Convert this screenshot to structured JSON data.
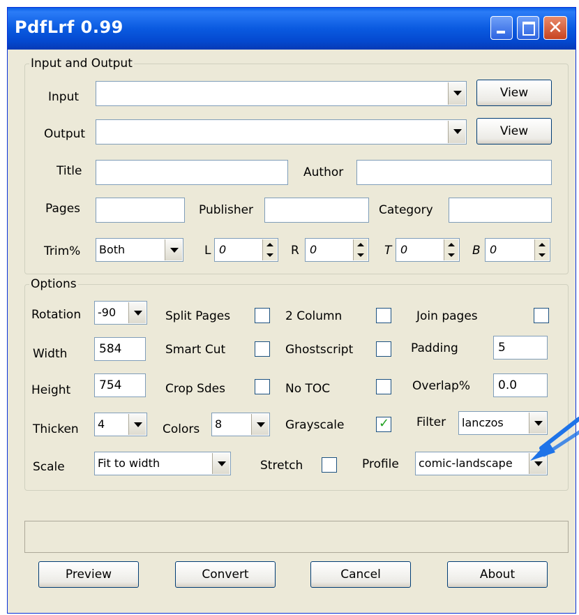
{
  "window": {
    "title": "PdfLrf 0.99"
  },
  "io": {
    "legend": "Input and Output",
    "input_label": "Input",
    "input_value": "",
    "input_view": "View",
    "output_label": "Output",
    "output_value": "",
    "output_view": "View",
    "title_label": "Title",
    "title_value": "",
    "author_label": "Author",
    "author_value": "",
    "pages_label": "Pages",
    "pages_value": "",
    "publisher_label": "Publisher",
    "publisher_value": "",
    "category_label": "Category",
    "category_value": "",
    "trim_label": "Trim%",
    "trim_value": "Both",
    "l_label": "L",
    "l_value": "0",
    "r_label": "R",
    "r_value": "0",
    "t_label": "T",
    "t_value": "0",
    "b_label": "B",
    "b_value": "0"
  },
  "options": {
    "legend": "Options",
    "rotation_label": "Rotation",
    "rotation_value": "-90",
    "split_pages_label": "Split Pages",
    "split_pages_checked": false,
    "two_column_label": "2 Column",
    "two_column_checked": false,
    "join_pages_label": "Join pages",
    "join_pages_checked": false,
    "width_label": "Width",
    "width_value": "584",
    "smart_cut_label": "Smart Cut",
    "smart_cut_checked": false,
    "ghostscript_label": "Ghostscript",
    "ghostscript_checked": false,
    "padding_label": "Padding",
    "padding_value": "5",
    "height_label": "Height",
    "height_value": "754",
    "crop_sides_label": "Crop Sdes",
    "crop_sides_checked": false,
    "no_toc_label": "No TOC",
    "no_toc_checked": false,
    "overlap_label": "Overlap%",
    "overlap_value": "0.0",
    "thicken_label": "Thicken",
    "thicken_value": "4",
    "colors_label": "Colors",
    "colors_value": "8",
    "grayscale_label": "Grayscale",
    "grayscale_checked": true,
    "filter_label": "Filter",
    "filter_value": "lanczos",
    "scale_label": "Scale",
    "scale_value": "Fit to width",
    "stretch_label": "Stretch",
    "stretch_checked": false,
    "profile_label": "Profile",
    "profile_value": "comic-landscape"
  },
  "buttons": {
    "preview": "Preview",
    "convert": "Convert",
    "cancel": "Cancel",
    "about": "About"
  },
  "colors": {
    "titlebar": "#0a5ae0",
    "window_bg": "#ece9d8",
    "annotation_arrow": "#1e73e8"
  }
}
